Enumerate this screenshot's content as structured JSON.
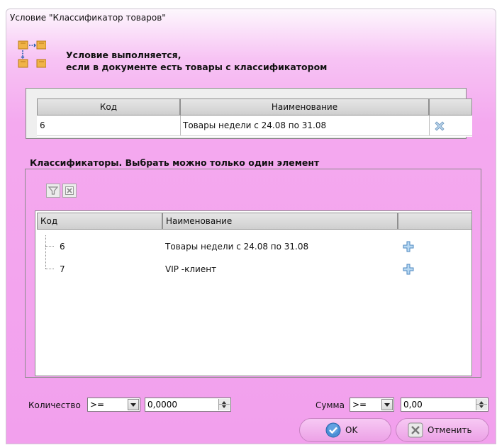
{
  "dialog": {
    "title": "Условие \"Классификатор товаров\"",
    "condition_line1": "Условие выполняется,",
    "condition_line2": "если в документе есть товары с классификатором"
  },
  "selected_table": {
    "columns": [
      "Код",
      "Наименование",
      ""
    ],
    "rows": [
      {
        "code": "6",
        "name": "Товары недели с 24.08 по 31.08",
        "action_icon": "remove-icon"
      }
    ]
  },
  "classifiers": {
    "label": "Классификаторы. Выбрать можно только один элемент",
    "toolbar": {
      "filter_icon": "filter-icon",
      "clear_filter_icon": "clear-filter-icon"
    },
    "columns": [
      "Код",
      "Наименование",
      ""
    ],
    "rows": [
      {
        "code": "6",
        "name": "Товары недели с 24.08 по 31.08",
        "action_icon": "add-icon"
      },
      {
        "code": "7",
        "name": "VIP -клиент",
        "action_icon": "add-icon"
      }
    ]
  },
  "quantity": {
    "label": "Количество",
    "operator": ">=",
    "value": "0,0000"
  },
  "sum": {
    "label": "Сумма",
    "operator": ">=",
    "value": "0,00"
  },
  "buttons": {
    "ok": "OK",
    "cancel": "Отменить"
  },
  "colors": {
    "accent_pink": "#f2a0ed",
    "icon_blue": "#5b9bd5"
  }
}
